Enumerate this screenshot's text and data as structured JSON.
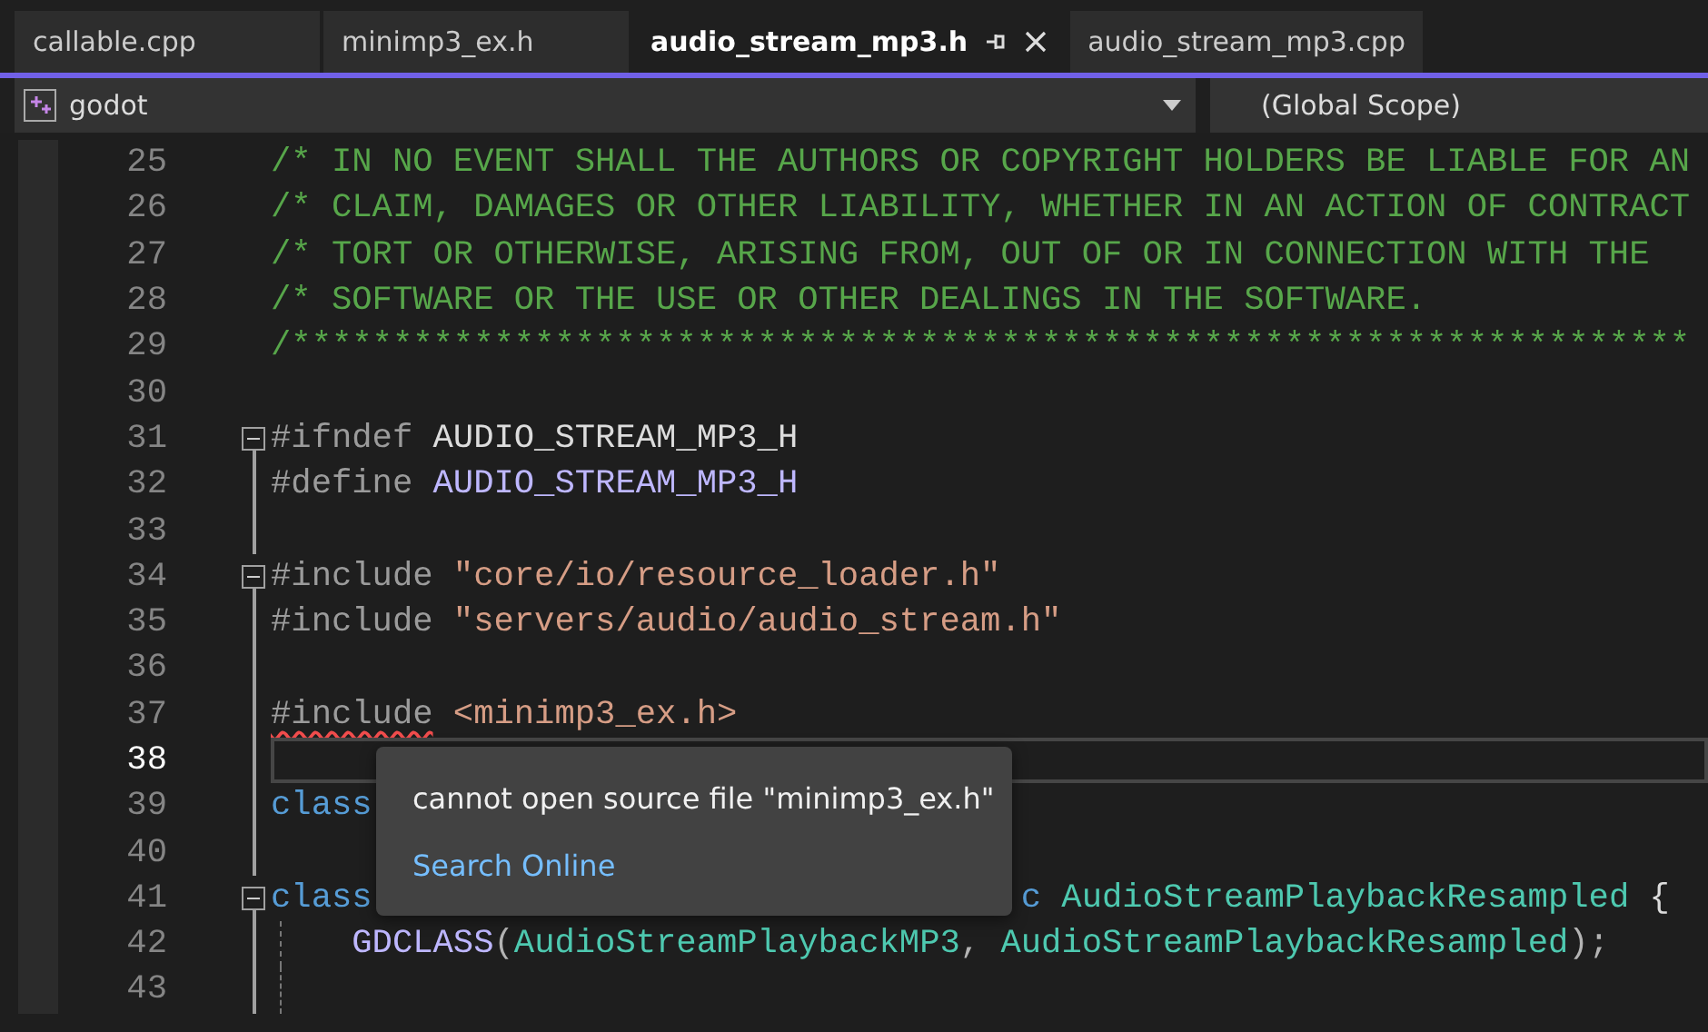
{
  "tabs": [
    {
      "label": "callable.cpp",
      "selected": false,
      "pinnable": false
    },
    {
      "label": "minimp3_ex.h",
      "selected": false,
      "pinnable": false
    },
    {
      "label": "audio_stream_mp3.h",
      "selected": true,
      "pinnable": true
    },
    {
      "label": "audio_stream_mp3.cpp",
      "selected": false,
      "pinnable": false
    }
  ],
  "navigation_bar": {
    "project": "godot",
    "scope": "(Global Scope)"
  },
  "code_lines": [
    {
      "number": "25",
      "current": false,
      "fold": false,
      "guide": false,
      "in_class": false,
      "tokens": [
        {
          "kind": "comment",
          "text": "/* IN NO EVENT SHALL THE AUTHORS OR COPYRIGHT HOLDERS BE LIABLE FOR AN"
        }
      ]
    },
    {
      "number": "26",
      "current": false,
      "fold": false,
      "guide": false,
      "in_class": false,
      "tokens": [
        {
          "kind": "comment",
          "text": "/* CLAIM, DAMAGES OR OTHER LIABILITY, WHETHER IN AN ACTION OF CONTRACT"
        }
      ]
    },
    {
      "number": "27",
      "current": false,
      "fold": false,
      "guide": false,
      "in_class": false,
      "tokens": [
        {
          "kind": "comment",
          "text": "/* TORT OR OTHERWISE, ARISING FROM, OUT OF OR IN CONNECTION WITH THE"
        }
      ]
    },
    {
      "number": "28",
      "current": false,
      "fold": false,
      "guide": false,
      "in_class": false,
      "tokens": [
        {
          "kind": "comment",
          "text": "/* SOFTWARE OR THE USE OR OTHER DEALINGS IN THE SOFTWARE."
        }
      ]
    },
    {
      "number": "29",
      "current": false,
      "fold": false,
      "guide": false,
      "in_class": false,
      "tokens": [
        {
          "kind": "comment",
          "text": "/*********************************************************************"
        }
      ]
    },
    {
      "number": "30",
      "current": false,
      "fold": false,
      "guide": false,
      "in_class": false
    },
    {
      "number": "31",
      "current": false,
      "fold": true,
      "guide": true,
      "in_class": false,
      "tokens": [
        {
          "kind": "directive",
          "text": "#ifndef"
        },
        {
          "kind": "plain",
          "text": " AUDIO_STREAM_MP3_H"
        }
      ]
    },
    {
      "number": "32",
      "current": false,
      "fold": false,
      "guide": true,
      "in_class": false,
      "tokens": [
        {
          "kind": "directive",
          "text": "#define"
        },
        {
          "kind": "macro",
          "text": " AUDIO_STREAM_MP3_H"
        }
      ]
    },
    {
      "number": "33",
      "current": false,
      "fold": false,
      "guide": true,
      "in_class": false
    },
    {
      "number": "34",
      "current": false,
      "fold": true,
      "guide": true,
      "in_class": false,
      "tokens": [
        {
          "kind": "directive",
          "text": "#include"
        },
        {
          "kind": "string",
          "text": " \"core/io/resource_loader.h\""
        }
      ]
    },
    {
      "number": "35",
      "current": false,
      "fold": false,
      "guide": true,
      "in_class": false,
      "tokens": [
        {
          "kind": "directive",
          "text": "#include"
        },
        {
          "kind": "string",
          "text": " \"servers/audio/audio_stream.h\""
        }
      ]
    },
    {
      "number": "36",
      "current": false,
      "fold": false,
      "guide": true,
      "in_class": false
    },
    {
      "number": "37",
      "current": false,
      "fold": false,
      "guide": true,
      "in_class": false,
      "tokens": [
        {
          "kind": "error",
          "text": "#include"
        },
        {
          "kind": "string",
          "text": " <minimp3_ex.h>"
        }
      ]
    },
    {
      "number": "38",
      "current": true,
      "fold": false,
      "guide": true,
      "in_class": false
    },
    {
      "number": "39",
      "current": false,
      "fold": false,
      "guide": true,
      "in_class": false,
      "tokens": [
        {
          "kind": "keyword",
          "text": "class"
        }
      ]
    },
    {
      "number": "40",
      "current": false,
      "fold": false,
      "guide": true,
      "in_class": false
    },
    {
      "number": "41",
      "current": false,
      "fold": true,
      "guide": true,
      "in_class": false,
      "tokens": [
        {
          "kind": "keyword",
          "text": "class"
        }
      ],
      "tokens_after_popup": [
        {
          "kind": "keyword",
          "text": "c"
        },
        {
          "kind": "type",
          "text": " AudioStreamPlaybackResampled"
        },
        {
          "kind": "plain",
          "text": " {"
        }
      ]
    },
    {
      "number": "42",
      "current": false,
      "fold": false,
      "guide": true,
      "in_class": true,
      "tokens": [
        {
          "kind": "macro",
          "text": "GDCLASS"
        },
        {
          "kind": "punct",
          "text": "("
        },
        {
          "kind": "type",
          "text": "AudioStreamPlaybackMP3"
        },
        {
          "kind": "punct",
          "text": ", "
        },
        {
          "kind": "type",
          "text": "AudioStreamPlaybackResampled"
        },
        {
          "kind": "punct",
          "text": ");"
        }
      ]
    },
    {
      "number": "43",
      "current": false,
      "fold": false,
      "guide": true,
      "in_class": true
    }
  ],
  "popup": {
    "message": "cannot open source file \"minimp3_ex.h\"",
    "link": "Search Online"
  }
}
